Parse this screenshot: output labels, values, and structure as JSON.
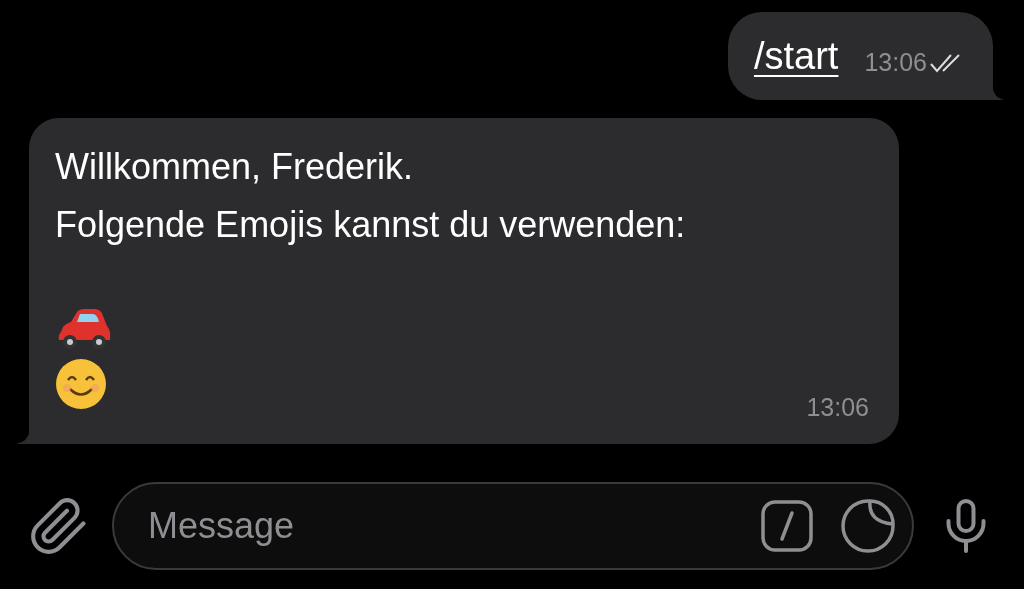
{
  "outgoing": {
    "text": "/start",
    "time": "13:06",
    "read": true
  },
  "incoming": {
    "lines": [
      "Willkommen, Frederik.",
      "Folgende Emojis kannst du verwenden:"
    ],
    "emojis": [
      {
        "kind": "car"
      },
      {
        "kind": "smile"
      }
    ],
    "time": "13:06"
  },
  "composer": {
    "placeholder": "Message"
  }
}
